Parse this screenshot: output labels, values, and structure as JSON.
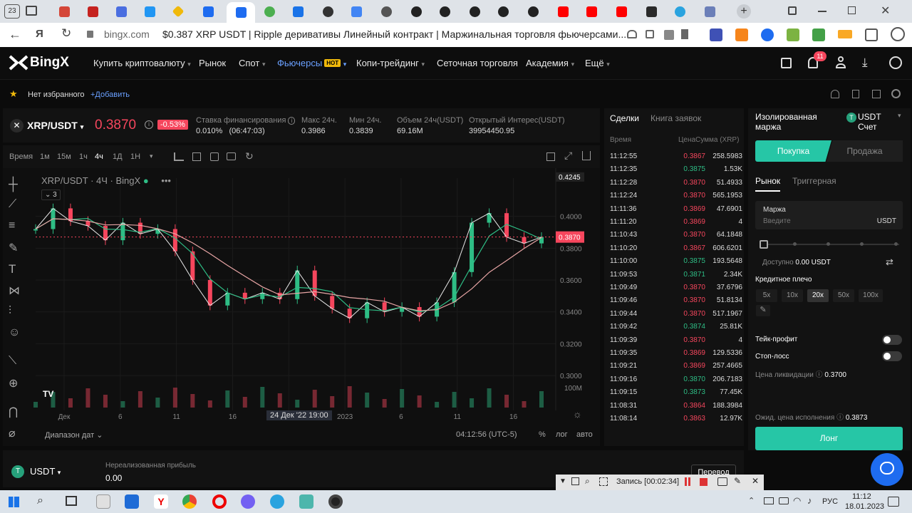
{
  "browser": {
    "tab_counter": "23",
    "url_domain": "bingx.com",
    "page_title": "$0.387 XRP USDT | Ripple деривативы Линейный контракт | Маржинальная торговля фьючерсами..."
  },
  "nav": {
    "logo": "BingX",
    "items": [
      "Купить криптовалюту",
      "Рынок",
      "Спот",
      "Фьючерсы",
      "Копи-трейдинг",
      "Сеточная торговля",
      "Академия",
      "Ещё"
    ],
    "hot_badge": "HOT",
    "notif_count": "11"
  },
  "favorites": {
    "empty_text": "Нет избранного",
    "add_label": "+Добавить"
  },
  "ticker": {
    "pair": "XRP/USDT",
    "price": "0.3870",
    "change": "-0.53%",
    "stats": [
      {
        "label": "Ставка финансирования",
        "value": "0.010%",
        "extra": "(06:47:03)"
      },
      {
        "label": "Макс 24ч.",
        "value": "0.3986"
      },
      {
        "label": "Мин 24ч.",
        "value": "0.3839"
      },
      {
        "label": "Объем 24ч(USDT)",
        "value": "69.16M"
      },
      {
        "label": "Открытый Интерес(USDT)",
        "value": "39954450.95"
      }
    ]
  },
  "chart_toolbar": {
    "time_label": "Время",
    "intervals": [
      "1м",
      "15м",
      "1ч",
      "4ч",
      "1Д",
      "1Н"
    ],
    "active_interval": "4ч"
  },
  "chart_data": {
    "type": "line",
    "title": "XRP/USDT · 4Ч · BingX",
    "legend_count": "3",
    "y_ticks": [
      "0.4245",
      "0.4000",
      "0.3800",
      "0.3600",
      "0.3400",
      "0.3200",
      "0.3000"
    ],
    "ylim": [
      0.296,
      0.424
    ],
    "x_ticks": [
      "Дек",
      "6",
      "11",
      "16",
      "21",
      "2023",
      "6",
      "11",
      "16"
    ],
    "crosshair_date": "24 Дек '22  19:00",
    "last_price_label": "0.3870",
    "volume_label": "100M",
    "series": [
      {
        "name": "",
        "values": [
          0.392,
          0.405,
          0.397,
          0.394,
          0.385,
          0.396,
          0.389,
          0.392,
          0.378,
          0.36,
          0.344,
          0.352,
          0.348,
          0.352,
          0.348,
          0.366,
          0.35,
          0.342,
          0.336,
          0.346,
          0.34,
          0.343,
          0.337,
          0.346,
          0.365,
          0.396,
          0.402,
          0.387,
          0.383,
          0.387
        ]
      }
    ],
    "grid": true
  },
  "chart_footer": {
    "range_label": "Диапазон дат",
    "clock": "04:12:56 (UTC-5)",
    "pct": "%",
    "log": "лог",
    "auto": "авто"
  },
  "trades": {
    "tabs": [
      "Сделки",
      "Книга заявок"
    ],
    "headers": [
      "Время",
      "Цена",
      "Сумма (XRP)"
    ],
    "rows": [
      {
        "time": "11:12:55",
        "price": "0.3867",
        "amount": "258.5983",
        "side": "sell"
      },
      {
        "time": "11:12:35",
        "price": "0.3875",
        "amount": "1.53K",
        "side": "buy"
      },
      {
        "time": "11:12:28",
        "price": "0.3870",
        "amount": "51.4933",
        "side": "sell"
      },
      {
        "time": "11:12:24",
        "price": "0.3870",
        "amount": "565.1953",
        "side": "sell"
      },
      {
        "time": "11:11:36",
        "price": "0.3869",
        "amount": "47.6901",
        "side": "sell"
      },
      {
        "time": "11:11:20",
        "price": "0.3869",
        "amount": "4",
        "side": "sell"
      },
      {
        "time": "11:10:43",
        "price": "0.3870",
        "amount": "64.1848",
        "side": "sell"
      },
      {
        "time": "11:10:20",
        "price": "0.3867",
        "amount": "606.6201",
        "side": "sell"
      },
      {
        "time": "11:10:00",
        "price": "0.3875",
        "amount": "193.5648",
        "side": "buy"
      },
      {
        "time": "11:09:53",
        "price": "0.3871",
        "amount": "2.34K",
        "side": "buy"
      },
      {
        "time": "11:09:49",
        "price": "0.3870",
        "amount": "37.6796",
        "side": "sell"
      },
      {
        "time": "11:09:46",
        "price": "0.3870",
        "amount": "51.8134",
        "side": "sell"
      },
      {
        "time": "11:09:44",
        "price": "0.3870",
        "amount": "517.1967",
        "side": "sell"
      },
      {
        "time": "11:09:42",
        "price": "0.3874",
        "amount": "25.81K",
        "side": "buy"
      },
      {
        "time": "11:09:39",
        "price": "0.3870",
        "amount": "4",
        "side": "sell"
      },
      {
        "time": "11:09:35",
        "price": "0.3869",
        "amount": "129.5336",
        "side": "sell"
      },
      {
        "time": "11:09:21",
        "price": "0.3869",
        "amount": "257.4665",
        "side": "sell"
      },
      {
        "time": "11:09:16",
        "price": "0.3870",
        "amount": "206.7183",
        "side": "buy"
      },
      {
        "time": "11:09:15",
        "price": "0.3873",
        "amount": "77.45K",
        "side": "buy"
      },
      {
        "time": "11:08:31",
        "price": "0.3864",
        "amount": "188.3984",
        "side": "sell"
      },
      {
        "time": "11:08:14",
        "price": "0.3863",
        "amount": "12.97K",
        "side": "sell"
      }
    ]
  },
  "order": {
    "margin_mode": "Изолированная маржа",
    "account": "USDT Счет",
    "buy": "Покупка",
    "sell": "Продажа",
    "tab_market": "Рынок",
    "tab_trigger": "Триггерная",
    "margin_label": "Маржа",
    "margin_placeholder": "Введите",
    "margin_unit": "USDT",
    "available_label": "Доступно",
    "available_value": "0.00 USDT",
    "slider_percent": 0,
    "leverage_label": "Кредитное плечо",
    "leverage_options": [
      "5x",
      "10x",
      "20x",
      "50x",
      "100x"
    ],
    "leverage_selected": "20x",
    "take_profit": "Тейк-профит",
    "stop_loss": "Стоп-лосс",
    "liq_label": "Цена ликвидации",
    "liq_value": "0.3700",
    "exec_label": "Ожид. цена исполнения",
    "exec_value": "0.3873",
    "long_button": "Лонг"
  },
  "bottom": {
    "currency": "USDT",
    "pnl_label": "Нереализованная прибыль",
    "pnl_value": "0.00",
    "transfer_label": "Перевод"
  },
  "recorder": {
    "status": "Запись [00:02:34]"
  },
  "taskbar": {
    "lang": "РУС",
    "time": "11:12",
    "date": "18.01.2023"
  },
  "colors": {
    "up": "#2ebd85",
    "down": "#f6465d",
    "accent": "#26c6a6",
    "brand_blue": "#1e6cf0"
  }
}
